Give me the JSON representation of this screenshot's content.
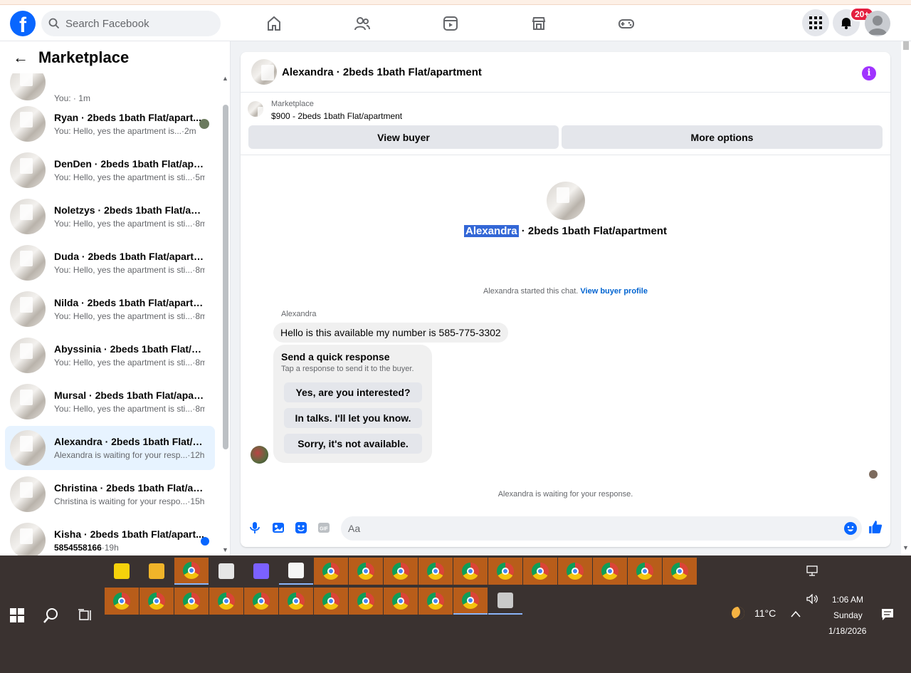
{
  "topbar": {
    "logo": "f",
    "search_placeholder": "Search Facebook",
    "notification_badge": "20+"
  },
  "sidebar": {
    "back": "←",
    "title": "Marketplace",
    "partial_preview": "You:",
    "partial_time": "1m",
    "conversations": [
      {
        "name": "Ryan · 2beds 1bath Flat/apart...",
        "preview": "You: Hello, yes the apartment is...",
        "time": "·2m"
      },
      {
        "name": "DenDen · 2beds 1bath Flat/apar...",
        "preview": "You: Hello, yes the apartment is sti...",
        "time": "·5m"
      },
      {
        "name": "Noletzys · 2beds 1bath Flat/apar...",
        "preview": "You: Hello, yes the apartment is sti...",
        "time": "·8m"
      },
      {
        "name": "Duda · 2beds 1bath Flat/apartm...",
        "preview": "You: Hello, yes the apartment is sti...",
        "time": "·8m"
      },
      {
        "name": "Nilda · 2beds 1bath Flat/apartm...",
        "preview": "You: Hello, yes the apartment is sti...",
        "time": "·8m"
      },
      {
        "name": "Abyssinia · 2beds 1bath Flat/apa...",
        "preview": "You: Hello, yes the apartment is sti...",
        "time": "·8m"
      },
      {
        "name": "Mursal · 2beds 1bath Flat/apart...",
        "preview": "You: Hello, yes the apartment is sti...",
        "time": "·8m"
      },
      {
        "name": "Alexandra · 2beds 1bath Flat/ap...",
        "preview": "Alexandra is waiting for your resp...",
        "time": "·12h"
      },
      {
        "name": "Christina · 2beds 1bath Flat/apar...",
        "preview": "Christina is waiting for your respo...",
        "time": "·15h"
      },
      {
        "name": "Kisha · 2beds 1bath Flat/apart...",
        "preview": "5854558166",
        "time": "·19h"
      }
    ]
  },
  "chat": {
    "title": "Alexandra · 2beds 1bath Flat/apartment",
    "info": "i",
    "listing_label": "Marketplace",
    "listing_price": "$900 - 2beds 1bath Flat/apartment",
    "view_buyer": "View buyer",
    "more_options": "More options",
    "center_name": "Alexandra",
    "center_rest": " · 2beds 1bath Flat/apartment",
    "started": "Alexandra started this chat.",
    "view_profile": "View buyer profile",
    "sender": "Alexandra",
    "message": "Hello is this available my number is 585-775-3302",
    "quick_title": "Send a quick response",
    "quick_sub": "Tap a response to send it to the buyer.",
    "quick_responses": [
      "Yes, are you interested?",
      "In talks. I'll let you know.",
      "Sorry, it's not available."
    ],
    "waiting": "Alexandra is waiting for your response.",
    "compose_placeholder": "Aa"
  },
  "taskbar": {
    "time": "1:06 AM",
    "day": "Sunday",
    "date": "1/18/2026",
    "temp": "11°C"
  }
}
